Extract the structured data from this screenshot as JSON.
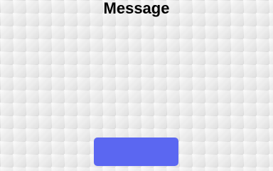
{
  "title": "Message",
  "colors": {
    "background": "#ededed",
    "button": "#5b67f1",
    "title_text": "#000000"
  }
}
